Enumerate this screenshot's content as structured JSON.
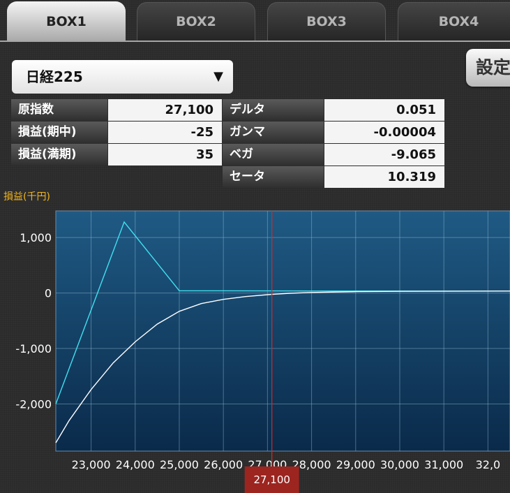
{
  "tabs": [
    {
      "label": "BOX1",
      "active": true
    },
    {
      "label": "BOX2",
      "active": false
    },
    {
      "label": "BOX3",
      "active": false
    },
    {
      "label": "BOX4",
      "active": false
    }
  ],
  "settings_label": "設定",
  "underlying_select": {
    "value": "日経225",
    "arrow": "▼"
  },
  "left_table": [
    {
      "label": "原指数",
      "value": "27,100"
    },
    {
      "label": "損益(期中)",
      "value": "-25"
    },
    {
      "label": "損益(満期)",
      "value": "35"
    }
  ],
  "greeks": [
    {
      "label": "デルタ",
      "value": "0.051"
    },
    {
      "label": "ガンマ",
      "value": "-0.00004"
    },
    {
      "label": "ベガ",
      "value": "-9.065"
    },
    {
      "label": "セータ",
      "value": "10.319"
    }
  ],
  "colors": {
    "expiry_line": "#40e0f0",
    "midterm_line": "#ffffff",
    "current_marker": "#d02a2a",
    "axis_title": "#f3b61e"
  },
  "chart_data": {
    "type": "line",
    "ylabel": "損益(千円)",
    "xlim": [
      22200,
      32500
    ],
    "ylim": [
      -2850,
      1480
    ],
    "x_ticks": [
      23000,
      24000,
      25000,
      26000,
      27000,
      28000,
      29000,
      30000,
      31000,
      32000
    ],
    "x_tick_labels": [
      "23,000",
      "24,000",
      "25,000",
      "26,000",
      "27,000",
      "28,000",
      "29,000",
      "30,000",
      "31,000",
      "32,0"
    ],
    "y_ticks": [
      1000,
      0,
      -1000,
      -2000
    ],
    "y_tick_labels": [
      "1,000",
      "0",
      "-1,000",
      "-2,000"
    ],
    "grid": true,
    "current_price": 27100,
    "current_price_label": "27,100",
    "series": [
      {
        "role": "expiry",
        "x": [
          22200,
          23750,
          25000,
          26000,
          27000,
          28000,
          32500
        ],
        "y": [
          -2000,
          1280,
          40,
          40,
          38,
          36,
          35
        ]
      },
      {
        "role": "midterm",
        "x": [
          22200,
          22500,
          23000,
          23500,
          24000,
          24500,
          25000,
          25500,
          26000,
          26500,
          27000,
          27100,
          27500,
          28000,
          29000,
          30000,
          32500
        ],
        "y": [
          -2700,
          -2300,
          -1740,
          -1260,
          -880,
          -560,
          -330,
          -190,
          -115,
          -65,
          -30,
          -25,
          -5,
          10,
          25,
          30,
          35
        ]
      }
    ]
  }
}
